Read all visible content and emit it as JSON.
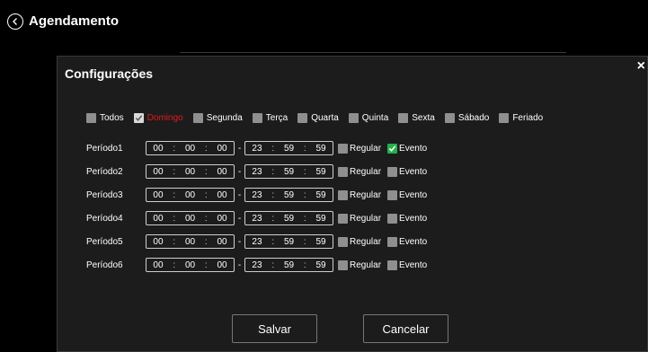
{
  "header": {
    "title": "Agendamento"
  },
  "dialog": {
    "title": "Configurações",
    "days": [
      {
        "label": "Todos",
        "checked": false,
        "highlight": false
      },
      {
        "label": "Domingo",
        "checked": true,
        "highlight": true
      },
      {
        "label": "Segunda",
        "checked": false,
        "highlight": false
      },
      {
        "label": "Terça",
        "checked": false,
        "highlight": false
      },
      {
        "label": "Quarta",
        "checked": false,
        "highlight": false
      },
      {
        "label": "Quinta",
        "checked": false,
        "highlight": false
      },
      {
        "label": "Sexta",
        "checked": false,
        "highlight": false
      },
      {
        "label": "Sábado",
        "checked": false,
        "highlight": false
      },
      {
        "label": "Feriado",
        "checked": false,
        "highlight": false
      }
    ],
    "periods": [
      {
        "label": "Período1",
        "start": [
          "00",
          "00",
          "00"
        ],
        "end": [
          "23",
          "59",
          "59"
        ],
        "regular": false,
        "evento": true
      },
      {
        "label": "Período2",
        "start": [
          "00",
          "00",
          "00"
        ],
        "end": [
          "23",
          "59",
          "59"
        ],
        "regular": false,
        "evento": false
      },
      {
        "label": "Período3",
        "start": [
          "00",
          "00",
          "00"
        ],
        "end": [
          "23",
          "59",
          "59"
        ],
        "regular": false,
        "evento": false
      },
      {
        "label": "Período4",
        "start": [
          "00",
          "00",
          "00"
        ],
        "end": [
          "23",
          "59",
          "59"
        ],
        "regular": false,
        "evento": false
      },
      {
        "label": "Período5",
        "start": [
          "00",
          "00",
          "00"
        ],
        "end": [
          "23",
          "59",
          "59"
        ],
        "regular": false,
        "evento": false
      },
      {
        "label": "Período6",
        "start": [
          "00",
          "00",
          "00"
        ],
        "end": [
          "23",
          "59",
          "59"
        ],
        "regular": false,
        "evento": false
      }
    ],
    "labels": {
      "regular": "Regular",
      "evento": "Evento",
      "dash": "-",
      "time_sep": ":"
    },
    "buttons": {
      "save": "Salvar",
      "cancel": "Cancelar"
    },
    "close_glyph": "×"
  },
  "colors": {
    "checked_green": "#22b14c",
    "highlight_red": "#e01b1b",
    "unchecked": "#8f8f8f"
  }
}
